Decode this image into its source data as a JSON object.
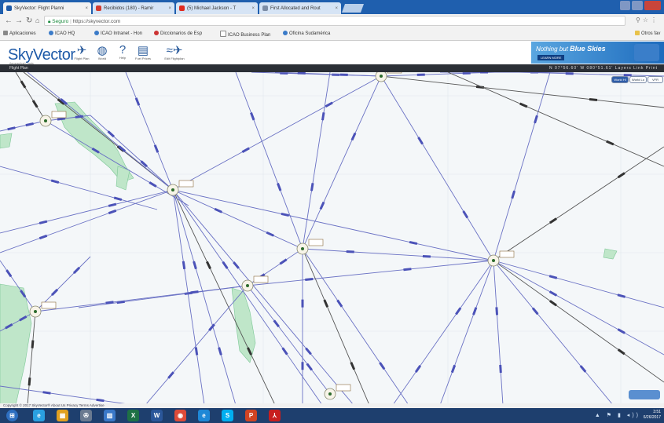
{
  "browser": {
    "tabs": [
      {
        "label": "SkyVector: Flight Planni",
        "color": "#1e5aa8",
        "active": true
      },
      {
        "label": "Recibidos (180) - Ramir",
        "color": "#d23b2f",
        "active": false
      },
      {
        "label": "(5) Michael Jackson - T",
        "color": "#e02a1f",
        "active": false
      },
      {
        "label": "First Allocated and Rout",
        "color": "#7c8da6",
        "active": false
      }
    ],
    "url_secure": "Seguro",
    "url": "https://skyvector.com",
    "bookmarks": [
      "Aplicaciones",
      "ICAO HQ",
      "ICAO Intranet - Hon",
      "Diccionarios de Esp",
      "ICAO Business Plan",
      "Oficina Sudamérica",
      "Otros fav"
    ]
  },
  "skyvector": {
    "logo": "SkyVector",
    "logo_tagline": "Aeronautical Charts",
    "nav_icons": [
      {
        "name": "flight-plan-icon",
        "glyph": "✈",
        "label": "Flight Plan"
      },
      {
        "name": "world-icon",
        "glyph": "◍",
        "label": "World"
      },
      {
        "name": "help-icon",
        "glyph": "?",
        "label": "Help"
      },
      {
        "name": "fuel-icon",
        "glyph": "▤",
        "label": "Fuel Prices"
      },
      {
        "name": "airplane-logo-icon",
        "glyph": "≈✈",
        "label": "Edit Flightplan"
      }
    ],
    "ad": {
      "line1": "Nothing but",
      "line1_bold": "Blue Skies",
      "button": "LEARN MORE"
    },
    "toolbar_left": "Flight Plan",
    "toolbar_right": "N 07°56.60' W 080°51.61'   Layers   Link   Print"
  },
  "map": {
    "buttons": [
      "World Hi",
      "World Lo",
      "VFR"
    ]
  },
  "status": "Copyright © 2017 SkyVector®  About Us  Privacy  Terms  Advertise",
  "taskbar": {
    "apps": [
      {
        "name": "ie-icon",
        "glyph": "e",
        "color": "#2aa0e0"
      },
      {
        "name": "explorer-icon",
        "glyph": "▦",
        "color": "#e0a020"
      },
      {
        "name": "settings-icon",
        "glyph": "✇",
        "color": "#6a7a90"
      },
      {
        "name": "calendar-icon",
        "glyph": "▥",
        "color": "#3a78c8"
      },
      {
        "name": "excel-icon",
        "glyph": "X",
        "color": "#1e7145"
      },
      {
        "name": "word-icon",
        "glyph": "W",
        "color": "#2b579a"
      },
      {
        "name": "chrome-icon",
        "glyph": "◉",
        "color": "#dd4b39"
      },
      {
        "name": "ie2-icon",
        "glyph": "e",
        "color": "#1e88d6"
      },
      {
        "name": "skype-icon",
        "glyph": "S",
        "color": "#00aff0"
      },
      {
        "name": "powerpoint-icon",
        "glyph": "P",
        "color": "#d04423"
      },
      {
        "name": "acrobat-icon",
        "glyph": "⅄",
        "color": "#c81e1e"
      }
    ],
    "time": "3:51",
    "date": "6/26/2017"
  }
}
